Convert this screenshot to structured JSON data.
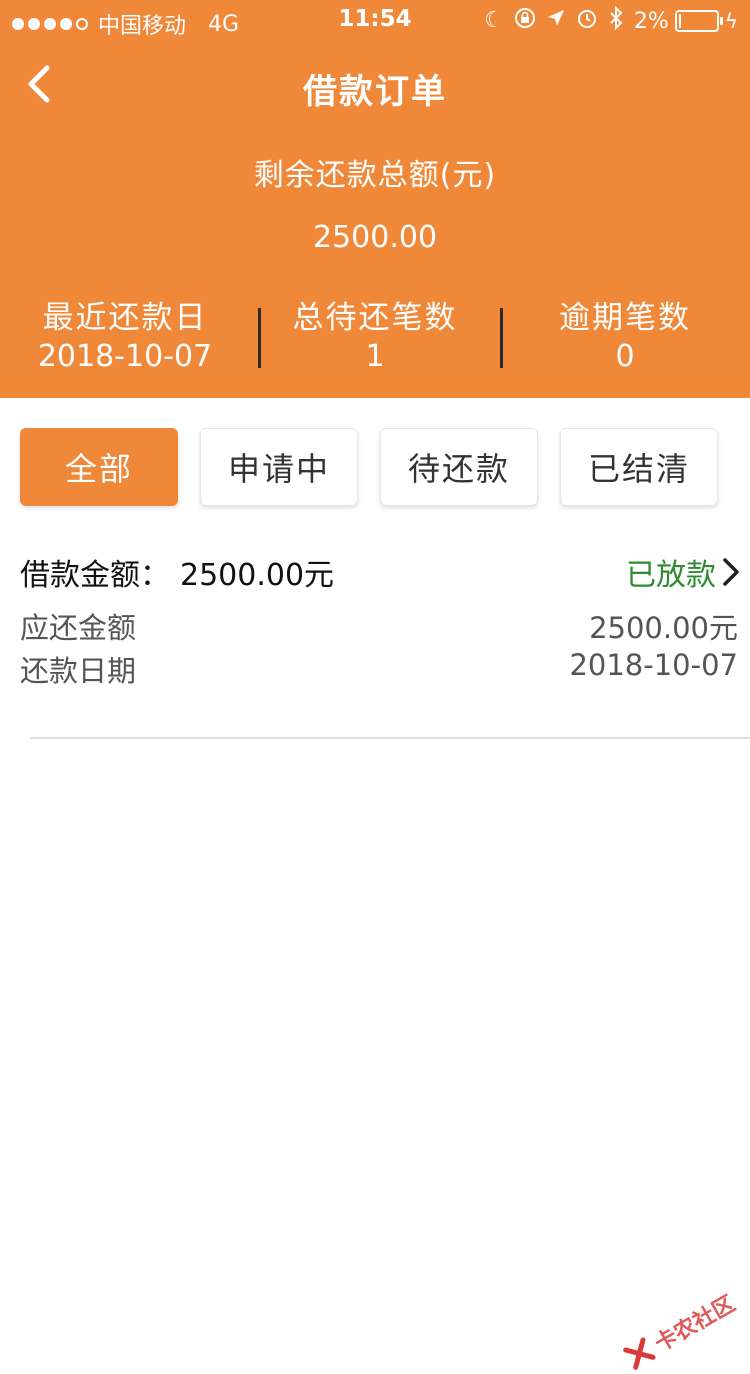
{
  "status_bar": {
    "carrier": "中国移动",
    "network": "4G",
    "time": "11:54",
    "battery": "2%"
  },
  "nav": {
    "title": "借款订单"
  },
  "summary": {
    "label": "剩余还款总额(元)",
    "amount": "2500.00",
    "stats": [
      {
        "label": "最近还款日",
        "value": "2018-10-07"
      },
      {
        "label": "总待还笔数",
        "value": "1"
      },
      {
        "label": "逾期笔数",
        "value": "0"
      }
    ]
  },
  "tabs": [
    {
      "label": "全部",
      "active": true
    },
    {
      "label": "申请中",
      "active": false
    },
    {
      "label": "待还款",
      "active": false
    },
    {
      "label": "已结清",
      "active": false
    }
  ],
  "order": {
    "loan_amount_label": "借款金额：",
    "loan_amount": "2500.00元",
    "status": "已放款",
    "due_amount_label": "应还金额",
    "due_amount": "2500.00元",
    "due_date_label": "还款日期",
    "due_date": "2018-10-07"
  },
  "watermark": {
    "text": "卡农社区"
  },
  "colors": {
    "primary": "#F0883A",
    "status_green": "#2E8B2E"
  }
}
